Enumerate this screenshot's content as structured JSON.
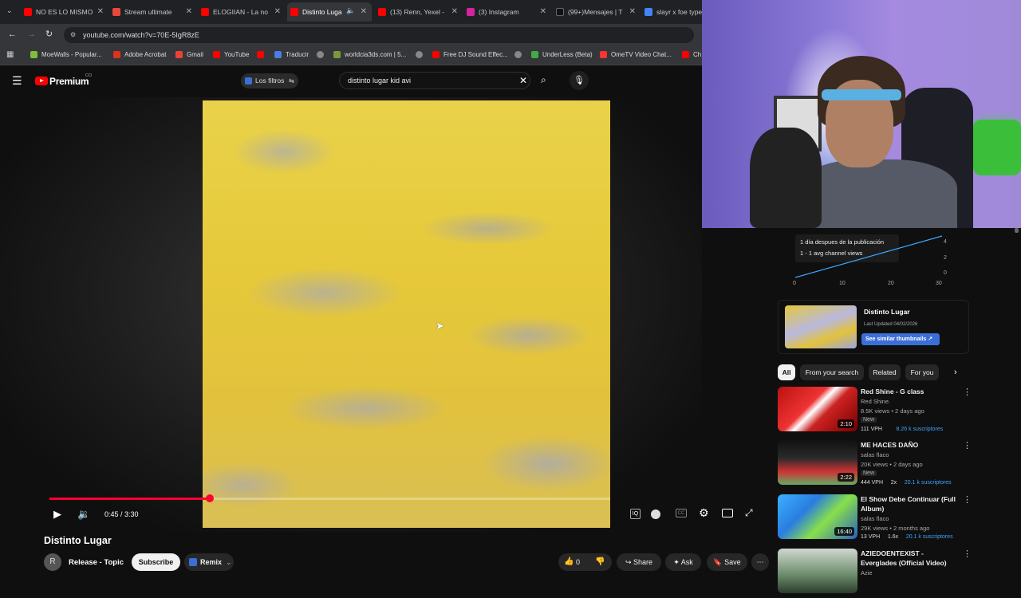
{
  "browser": {
    "tabs": [
      {
        "label": "NO ES LO MISMO",
        "color": "#ff0000"
      },
      {
        "label": "Stream ultimate",
        "color": "#e8493a"
      },
      {
        "label": "ELOGIIAN - La no",
        "color": "#ff0000"
      },
      {
        "label": "Distinto Luga",
        "color": "#ff0000",
        "active": true
      },
      {
        "label": "(13) Renn, Yexel -",
        "color": "#ff0000"
      },
      {
        "label": "(3) Instagram",
        "color": "#d6249f"
      },
      {
        "label": "(99+)Mensajes | T",
        "color": "#111111"
      },
      {
        "label": "slayr x foe type",
        "color": "#4285f4"
      }
    ],
    "url": "youtube.com/watch?v=70E-5IgR8zE",
    "bookmarks": [
      {
        "label": "MoeWalls - Popular...",
        "color": "#7bbf3b"
      },
      {
        "label": "Adobe Acrobat",
        "color": "#e0301e"
      },
      {
        "label": "Gmail",
        "color": "#ea4335"
      },
      {
        "label": "YouTube",
        "color": "#ff0000"
      },
      {
        "label": "",
        "color": "#ff0000"
      },
      {
        "label": "Traducir",
        "color": "#4a7de0"
      },
      {
        "label": "",
        "color": "#888888"
      },
      {
        "label": "worldcia3ds.com | 5...",
        "color": "#7a9a3a"
      },
      {
        "label": "",
        "color": "#888888"
      },
      {
        "label": "Free DJ Sound Effec...",
        "color": "#ff0000"
      },
      {
        "label": "",
        "color": "#888888"
      },
      {
        "label": "UnderLess (Beta)",
        "color": "#44aa44"
      },
      {
        "label": "OmeTV Video Chat...",
        "color": "#ff3333"
      },
      {
        "label": "Ch",
        "color": "#ff0000"
      }
    ]
  },
  "youtube": {
    "logo": "Premium",
    "logo_sup": "CO",
    "filter_button": "Los filtros",
    "search_query": "distinto lugar kid avi",
    "player": {
      "time": "0:45 / 3:30",
      "progress": 0.2857
    },
    "video_title": "Distinto Lugar",
    "channel": {
      "avatar_letter": "R",
      "name": "Release - Topic",
      "subscribe": "Subscribe",
      "remix": "Remix"
    },
    "actions": {
      "likes": "0",
      "share": "Share",
      "ask": "Ask",
      "save": "Save"
    }
  },
  "sidebar": {
    "stats": {
      "line1": "1 día despues de la publicación",
      "line2": "1 - 1 avg channel views",
      "y_ticks": [
        "4",
        "2",
        "0"
      ],
      "x_ticks": [
        "0",
        "10",
        "20",
        "30"
      ]
    },
    "thumb_card": {
      "title": "Distinto Lugar",
      "updated": "Last Updated 04/02/2026",
      "button": "See similar thumbnails"
    },
    "chips": [
      "All",
      "From your search",
      "Related",
      "For you"
    ],
    "recommendations": [
      {
        "title": "Red Shine - G class",
        "channel": "Red Shine.",
        "meta": "8.5K views • 2 days ago",
        "badge": "New",
        "vph": "111 VPH",
        "subs": "8.26 k suscriptores",
        "mult": "",
        "duration": "2:10"
      },
      {
        "title": "ME HACES DAÑO",
        "channel": "salas flaco",
        "meta": "20K views • 2 days ago",
        "badge": "New",
        "vph": "444 VPH",
        "subs": "20.1 k suscriptores",
        "mult": "2x",
        "duration": "2:22"
      },
      {
        "title": "El Show Debe Continuar (Full Album)",
        "channel": "salas flaco",
        "meta": "29K views • 2 months ago",
        "badge": "",
        "vph": "13 VPH",
        "subs": "20.1 k suscriptores",
        "mult": "1.6x",
        "duration": "16:40"
      },
      {
        "title": "AZIEDOENTEXIST - Everglades (Official Video)",
        "channel": "Azie",
        "meta": "",
        "badge": "",
        "vph": "",
        "subs": "",
        "mult": "",
        "duration": ""
      }
    ]
  }
}
